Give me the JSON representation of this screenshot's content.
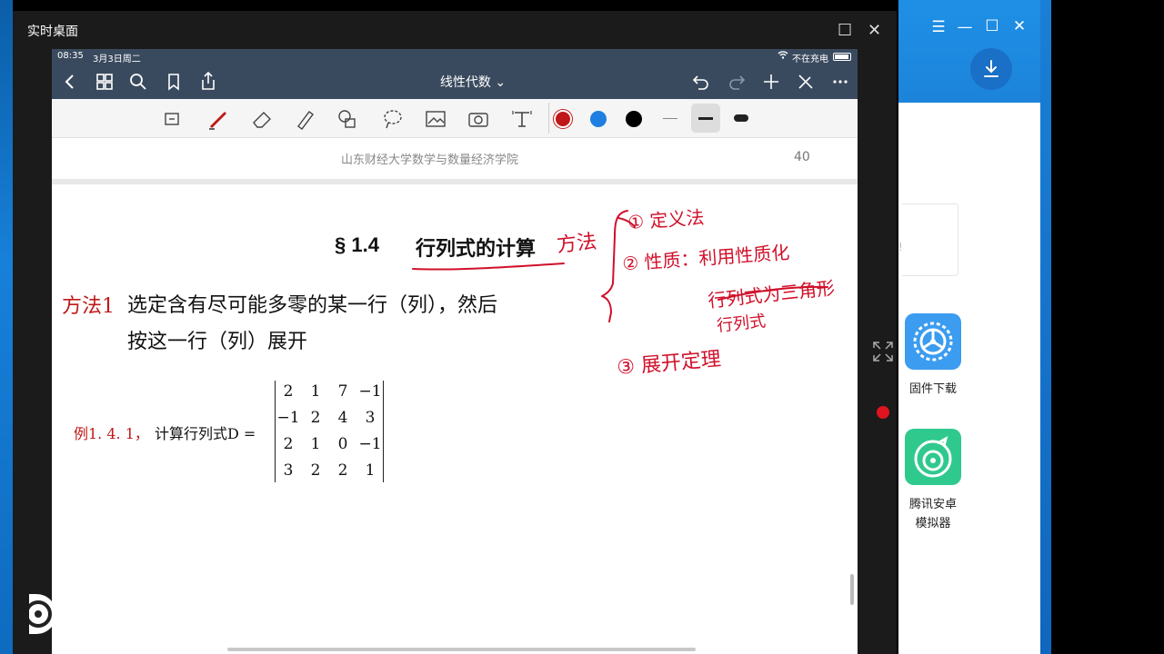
{
  "window": {
    "title": "实时桌面"
  },
  "ipad_status": {
    "time": "08:35",
    "date": "3月3日周二",
    "battery": "不在充电"
  },
  "navbar": {
    "doc_title": "线性代数 ⌄"
  },
  "page": {
    "header_school": "山东财经大学数学与数量经济学院",
    "header_page": "40",
    "section_num": "§ 1.4",
    "section_title": "行列式的计算",
    "method_label": "方法1",
    "method_line1": "选定含有尽可能多零的某一行（列），然后",
    "method_line2": "按这一行（列）展开",
    "example_label": "例1. 4. 1，",
    "example_text": "计算行列式D =",
    "matrix": [
      [
        "2",
        "1",
        "7",
        "−1"
      ],
      [
        "−1",
        "2",
        "4",
        "3"
      ],
      [
        "2",
        "1",
        "0",
        "−1"
      ],
      [
        "3",
        "2",
        "2",
        "1"
      ]
    ]
  },
  "annotations": {
    "method_word": "方法",
    "item1": "① 定义法",
    "item2": "② 性质：利用性质化",
    "item2b": "行列式为三角形",
    "item2c": "行列式",
    "item3": "③ 展开定理"
  },
  "side_app": {
    "firmware_label": "固件下载",
    "tencent_label_1": "腾讯安卓",
    "tencent_label_2": "模拟器",
    "notice_mark": "!"
  },
  "colors": {
    "ink_red": "#d0102a",
    "nav_bg": "#3a4a5e",
    "tool_blue": "#1e7fe0"
  }
}
